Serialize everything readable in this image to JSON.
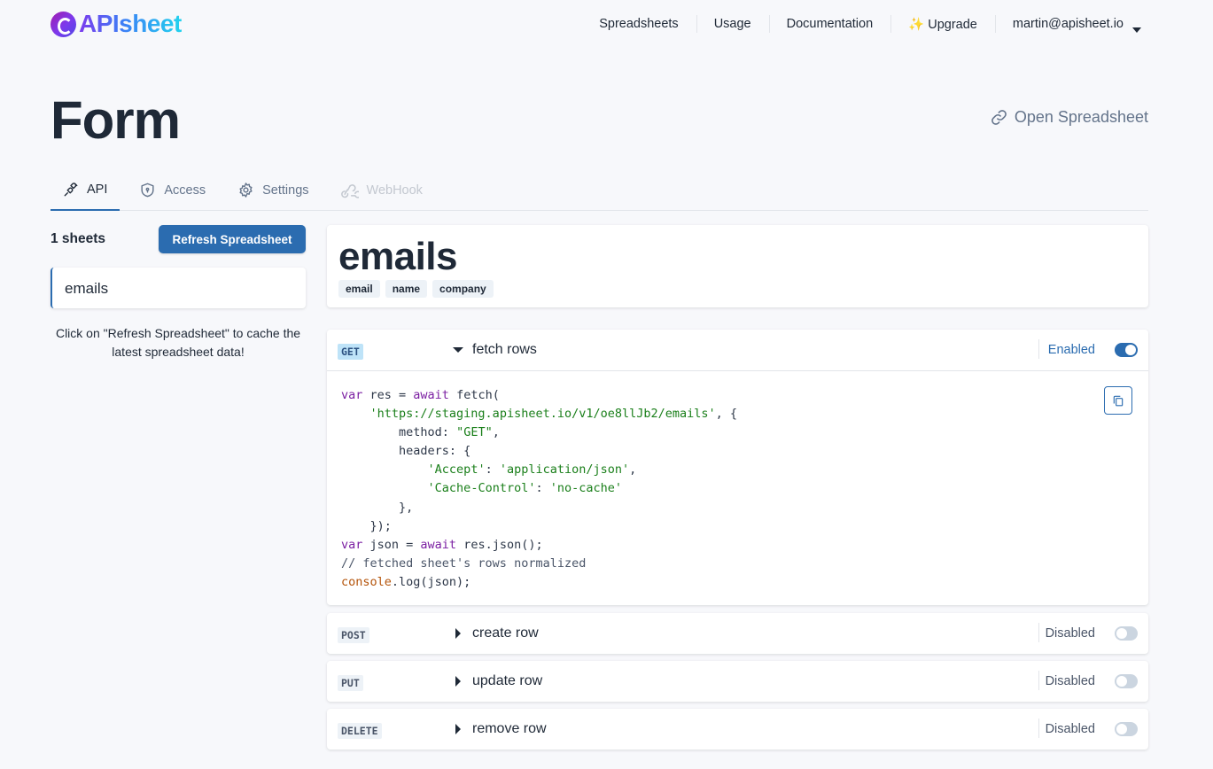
{
  "brand": {
    "name": "APIsheet"
  },
  "nav": {
    "links": [
      "Spreadsheets",
      "Usage",
      "Documentation",
      "✨ Upgrade"
    ],
    "account": "martin@apisheet.io"
  },
  "header": {
    "title": "Form",
    "open_link": "Open Spreadsheet"
  },
  "tabs": [
    {
      "label": "API",
      "icon": "api-plug-icon",
      "state": "active"
    },
    {
      "label": "Access",
      "icon": "shield-lock-icon",
      "state": "normal"
    },
    {
      "label": "Settings",
      "icon": "gear-icon",
      "state": "normal"
    },
    {
      "label": "WebHook",
      "icon": "webhook-icon",
      "state": "disabled"
    }
  ],
  "sidebar": {
    "count": "1 sheets",
    "refresh_label": "Refresh Spreadsheet",
    "sheets": [
      "emails"
    ],
    "hint": "Click on \"Refresh Spreadsheet\" to cache the latest spreadsheet data!"
  },
  "sheet": {
    "name": "emails",
    "columns": [
      "email",
      "name",
      "company"
    ]
  },
  "endpoints": [
    {
      "method": "GET",
      "title": "fetch rows",
      "status": "Enabled",
      "enabled": true,
      "expanded": true
    },
    {
      "method": "POST",
      "title": "create row",
      "status": "Disabled",
      "enabled": false,
      "expanded": false
    },
    {
      "method": "PUT",
      "title": "update row",
      "status": "Disabled",
      "enabled": false,
      "expanded": false
    },
    {
      "method": "DELETE",
      "title": "remove row",
      "status": "Disabled",
      "enabled": false,
      "expanded": false
    }
  ],
  "code": {
    "line1_kw": "var",
    "line1_a": " res = ",
    "line1_kw2": "await",
    "line1_b": " fetch(",
    "url": "'https://staging.apisheet.io/v1/oe8llJb2/emails'",
    "url_tail": ", {",
    "method_key": "method: ",
    "method_val": "\"GET\"",
    "method_tail": ",",
    "headers_open": "headers: {",
    "accept_key": "'Accept'",
    "accept_val": "'application/json'",
    "cache_key": "'Cache-Control'",
    "cache_val": "'no-cache'",
    "headers_close": "},",
    "fetch_close": "});",
    "line_json_kw": "var",
    "line_json_a": " json = ",
    "line_json_kw2": "await",
    "line_json_b": " res.json();",
    "comment": "// fetched sheet's rows normalized",
    "console_obj": "console",
    "console_call": ".log(json);"
  },
  "colors": {
    "accent": "#2b6cb0",
    "background": "#f7f8fb",
    "text": "#1f2937",
    "muted": "#64748b"
  }
}
